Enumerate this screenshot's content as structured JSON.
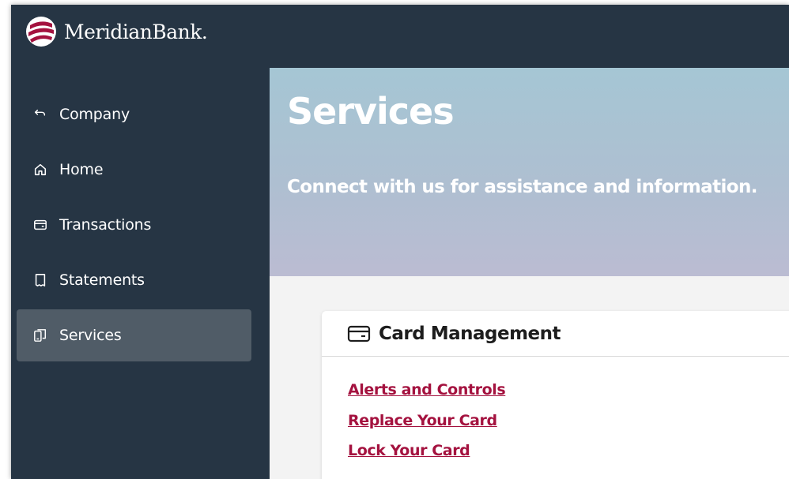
{
  "brand": {
    "name": "MeridianBank."
  },
  "sidebar": {
    "items": [
      {
        "label": "Company",
        "icon": "back-arrow-icon"
      },
      {
        "label": "Home",
        "icon": "home-icon"
      },
      {
        "label": "Transactions",
        "icon": "card-icon"
      },
      {
        "label": "Statements",
        "icon": "receipt-icon"
      },
      {
        "label": "Services",
        "icon": "devices-icon",
        "active": true
      }
    ]
  },
  "hero": {
    "title": "Services",
    "subtitle": "Connect with us for assistance and information."
  },
  "card": {
    "title": "Card Management",
    "icon": "credit-card-icon",
    "links": [
      {
        "label": "Alerts and Controls"
      },
      {
        "label": "Replace Your Card"
      },
      {
        "label": "Lock Your Card"
      }
    ]
  },
  "colors": {
    "sidebar_bg": "#263544",
    "active_item_bg": "#505c67",
    "link": "#a4123f",
    "hero_start": "#a5c6d4",
    "hero_end": "#bbbcd2"
  }
}
